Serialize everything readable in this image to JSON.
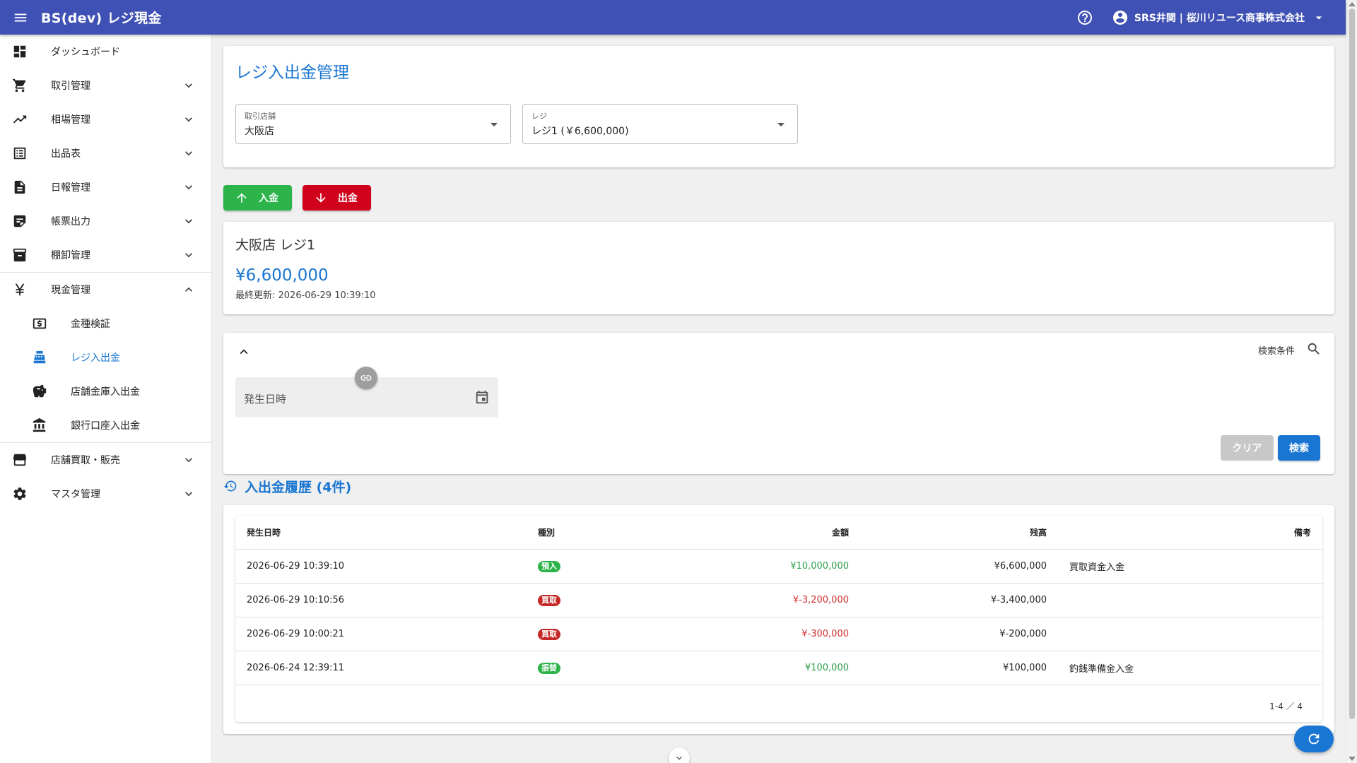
{
  "app": {
    "title": "BS(dev) レジ現金",
    "user_label": "SRS井関 | 桜川リユース商事株式会社"
  },
  "sidebar": {
    "items": [
      {
        "label": "ダッシュボード",
        "icon": "dashboard-icon"
      },
      {
        "label": "取引管理",
        "icon": "cart-icon"
      },
      {
        "label": "相場管理",
        "icon": "trending-up-icon"
      },
      {
        "label": "出品表",
        "icon": "list-icon"
      },
      {
        "label": "日報管理",
        "icon": "document-icon"
      },
      {
        "label": "帳票出力",
        "icon": "note-icon"
      },
      {
        "label": "棚卸管理",
        "icon": "archive-icon"
      },
      {
        "label": "現金管理",
        "icon": "yen-icon"
      },
      {
        "label": "店舗買取・販売",
        "icon": "store-icon"
      },
      {
        "label": "マスタ管理",
        "icon": "gear-icon"
      }
    ],
    "cash_sub": [
      {
        "label": "金種検証",
        "icon": "money-icon"
      },
      {
        "label": "レジ入出金",
        "icon": "register-icon"
      },
      {
        "label": "店舗金庫入出金",
        "icon": "piggy-bank-icon"
      },
      {
        "label": "銀行口座入出金",
        "icon": "bank-icon"
      }
    ]
  },
  "page": {
    "title": "レジ入出金管理",
    "store_select": {
      "label": "取引店舗",
      "value": "大阪店"
    },
    "register_select": {
      "label": "レジ",
      "value": "レジ1 (￥6,600,000)"
    },
    "deposit_label": "入金",
    "withdraw_label": "出金"
  },
  "balance": {
    "title": "大阪店 レジ1",
    "amount": "¥6,600,000",
    "updated": "最終更新: 2026-06-29 10:39:10"
  },
  "search": {
    "conditions_label": "検索条件",
    "date_placeholder": "発生日時",
    "clear_label": "クリア",
    "search_label": "検索"
  },
  "history": {
    "title": "入出金履歴 (4件)",
    "headers": [
      "発生日時",
      "種別",
      "金額",
      "残高",
      "備考"
    ],
    "rows": [
      {
        "datetime": "2026-06-29 10:39:10",
        "type": "預入",
        "type_color": "#2cb34a",
        "amount": "¥10,000,000",
        "amount_class": "pos",
        "balance": "¥6,600,000",
        "note": "買取資金入金"
      },
      {
        "datetime": "2026-06-29 10:10:56",
        "type": "買取",
        "type_color": "#c62828",
        "amount": "¥-3,200,000",
        "amount_class": "neg",
        "balance": "¥-3,400,000",
        "note": ""
      },
      {
        "datetime": "2026-06-29 10:00:21",
        "type": "買取",
        "type_color": "#c62828",
        "amount": "¥-300,000",
        "amount_class": "neg",
        "balance": "¥-200,000",
        "note": ""
      },
      {
        "datetime": "2026-06-24 12:39:11",
        "type": "振替",
        "type_color": "#2cb34a",
        "amount": "¥100,000",
        "amount_class": "pos",
        "balance": "¥100,000",
        "note": "釣銭準備金入金"
      }
    ],
    "pagination": "1-4 ／ 4"
  },
  "colors": {
    "primary": "#3f51b5",
    "accent": "#1976d2",
    "deposit": "#2cb34a",
    "withdraw": "#d0021b"
  }
}
